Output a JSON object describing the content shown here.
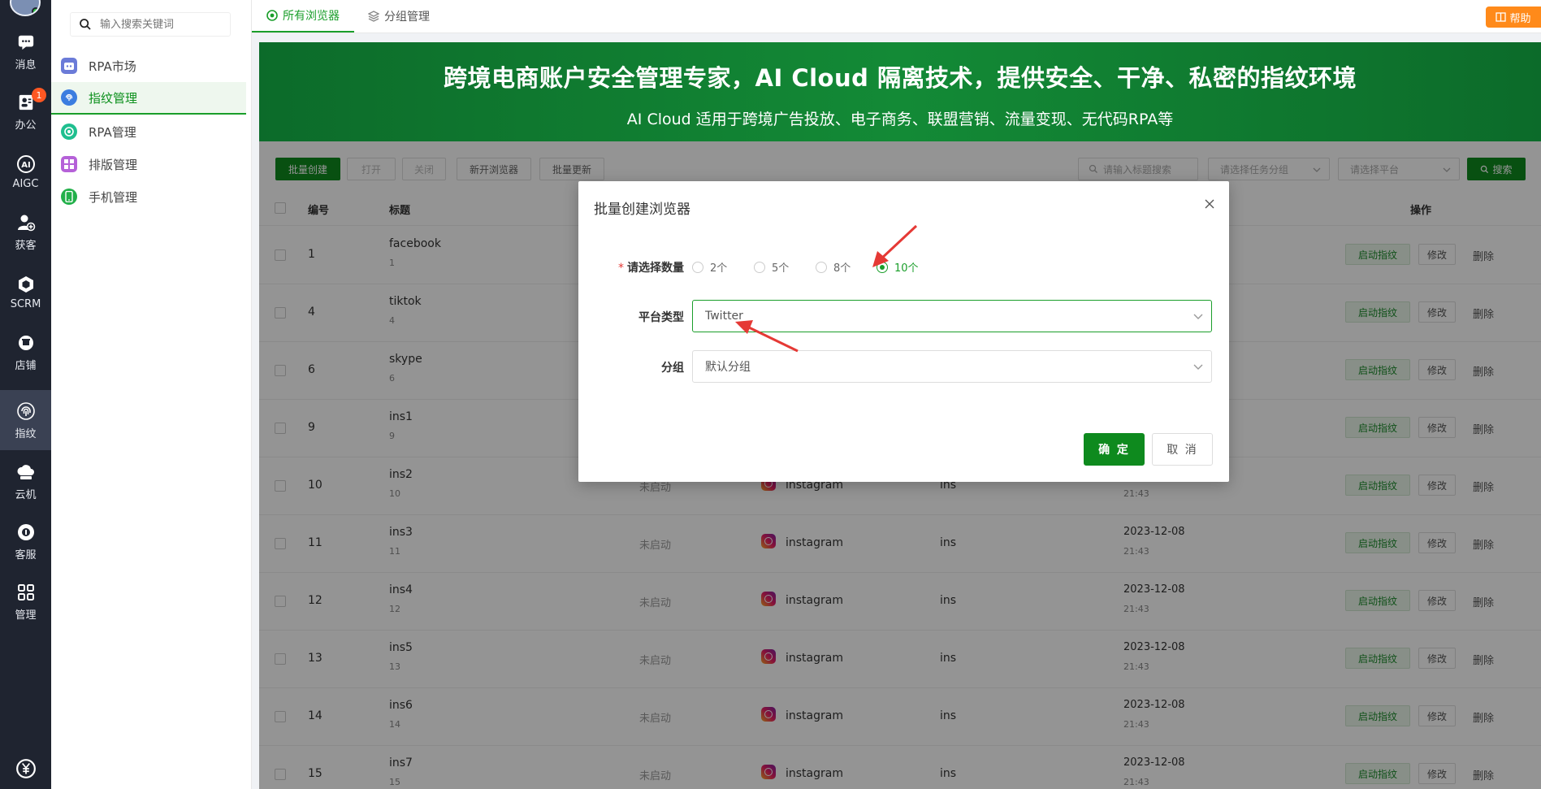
{
  "rail": {
    "items": [
      {
        "label": "消息"
      },
      {
        "label": "办公",
        "badge": "1"
      },
      {
        "label": "AIGC"
      },
      {
        "label": "获客"
      },
      {
        "label": "SCRM"
      },
      {
        "label": "店铺"
      },
      {
        "label": "指纹"
      },
      {
        "label": "云机"
      },
      {
        "label": "客服"
      },
      {
        "label": "管理"
      }
    ]
  },
  "sidebar": {
    "search_placeholder": "输入搜索关键词",
    "items": [
      {
        "label": "RPA市场",
        "icon": "robot-icon",
        "color": "#6b7bd8"
      },
      {
        "label": "指纹管理",
        "icon": "fingerprint-icon",
        "color": "#3b7de0"
      },
      {
        "label": "RPA管理",
        "icon": "target-icon",
        "color": "#1fbf8f"
      },
      {
        "label": "排版管理",
        "icon": "grid-icon",
        "color": "#b561d8"
      },
      {
        "label": "手机管理",
        "icon": "phone-icon",
        "color": "#22b04a"
      }
    ]
  },
  "tabs": [
    {
      "label": "所有浏览器"
    },
    {
      "label": "分组管理"
    }
  ],
  "help_label": "帮助",
  "banner": {
    "title": "跨境电商账户安全管理专家，AI Cloud 隔离技术，提供安全、干净、私密的指纹环境",
    "subtitle": "AI Cloud 适用于跨境广告投放、电子商务、联盟营销、流量变现、无代码RPA等"
  },
  "toolbar": {
    "batch_create": "批量创建",
    "open": "打开",
    "close": "关闭",
    "new_browser": "新开浏览器",
    "batch_update": "批量更新",
    "search_placeholder": "请输入标题搜索",
    "group_placeholder": "请选择任务分组",
    "platform_placeholder": "请选择平台",
    "search_button": "搜索"
  },
  "table": {
    "headers": {
      "id": "编号",
      "title": "标题",
      "actions": "操作"
    },
    "rows": [
      {
        "id": "1",
        "title": "facebook",
        "sub": "1",
        "status": "",
        "platform": "",
        "group": "",
        "date": "",
        "time": ""
      },
      {
        "id": "4",
        "title": "tiktok",
        "sub": "4",
        "status": "",
        "platform": "",
        "group": "",
        "date": "",
        "time": ""
      },
      {
        "id": "6",
        "title": "skype",
        "sub": "6",
        "status": "",
        "platform": "",
        "group": "",
        "date": "",
        "time": ""
      },
      {
        "id": "9",
        "title": "ins1",
        "sub": "9",
        "status": "",
        "platform": "",
        "group": "",
        "date": "",
        "time": ""
      },
      {
        "id": "10",
        "title": "ins2",
        "sub": "10",
        "status": "未启动",
        "platform": "instagram",
        "group": "ins",
        "date": "",
        "time": "21:43"
      },
      {
        "id": "11",
        "title": "ins3",
        "sub": "11",
        "status": "未启动",
        "platform": "instagram",
        "group": "ins",
        "date": "2023-12-08",
        "time": "21:43"
      },
      {
        "id": "12",
        "title": "ins4",
        "sub": "12",
        "status": "未启动",
        "platform": "instagram",
        "group": "ins",
        "date": "2023-12-08",
        "time": "21:43"
      },
      {
        "id": "13",
        "title": "ins5",
        "sub": "13",
        "status": "未启动",
        "platform": "instagram",
        "group": "ins",
        "date": "2023-12-08",
        "time": "21:43"
      },
      {
        "id": "14",
        "title": "ins6",
        "sub": "14",
        "status": "未启动",
        "platform": "instagram",
        "group": "ins",
        "date": "2023-12-08",
        "time": "21:43"
      },
      {
        "id": "15",
        "title": "ins7",
        "sub": "15",
        "status": "未启动",
        "platform": "instagram",
        "group": "ins",
        "date": "2023-12-08",
        "time": "21:43"
      }
    ],
    "row_actions": {
      "start": "启动指纹",
      "edit": "修改",
      "delete": "删除"
    }
  },
  "modal": {
    "title": "批量创建浏览器",
    "quantity_label": "请选择数量",
    "quantity_options": [
      "2个",
      "5个",
      "8个",
      "10个"
    ],
    "quantity_selected": "10个",
    "platform_label": "平台类型",
    "platform_value": "Twitter",
    "group_label": "分组",
    "group_value": "默认分组",
    "ok": "确 定",
    "cancel": "取 消"
  },
  "colors": {
    "accent": "#1a9e2a",
    "banner": "#0e7a2f",
    "annotation": "#e53935"
  }
}
